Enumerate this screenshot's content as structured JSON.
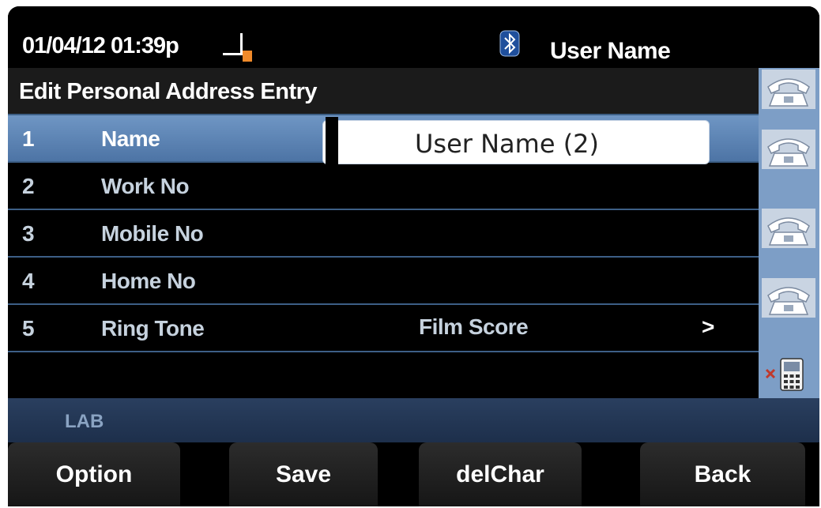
{
  "status_bar": {
    "datetime": "01/04/12 01:39p",
    "line_icon": "line-status-icon",
    "bluetooth_icon": "bluetooth-icon",
    "user_name": "User Name"
  },
  "screen": {
    "title": "Edit Personal Address Entry",
    "rows": [
      {
        "number": "1",
        "label": "Name",
        "value": "User Name (2)",
        "selected": true
      },
      {
        "number": "2",
        "label": "Work No",
        "value": ""
      },
      {
        "number": "3",
        "label": "Mobile No",
        "value": ""
      },
      {
        "number": "4",
        "label": "Home No",
        "value": ""
      },
      {
        "number": "5",
        "label": "Ring Tone",
        "value": "Film Score",
        "chevron": ">"
      }
    ]
  },
  "line_keys": [
    "phone-handset-icon",
    "phone-handset-icon",
    "phone-handset-icon",
    "phone-handset-icon",
    "missed-call-icon"
  ],
  "footer": {
    "label": "LAB"
  },
  "softkeys": [
    "Option",
    "Save",
    "delChar",
    "Back"
  ],
  "colors": {
    "selected_row": "#5b82b3",
    "row_divider": "#3d5f86",
    "sidebar": "#7d9ec6",
    "footer_bar": "#24375a"
  }
}
